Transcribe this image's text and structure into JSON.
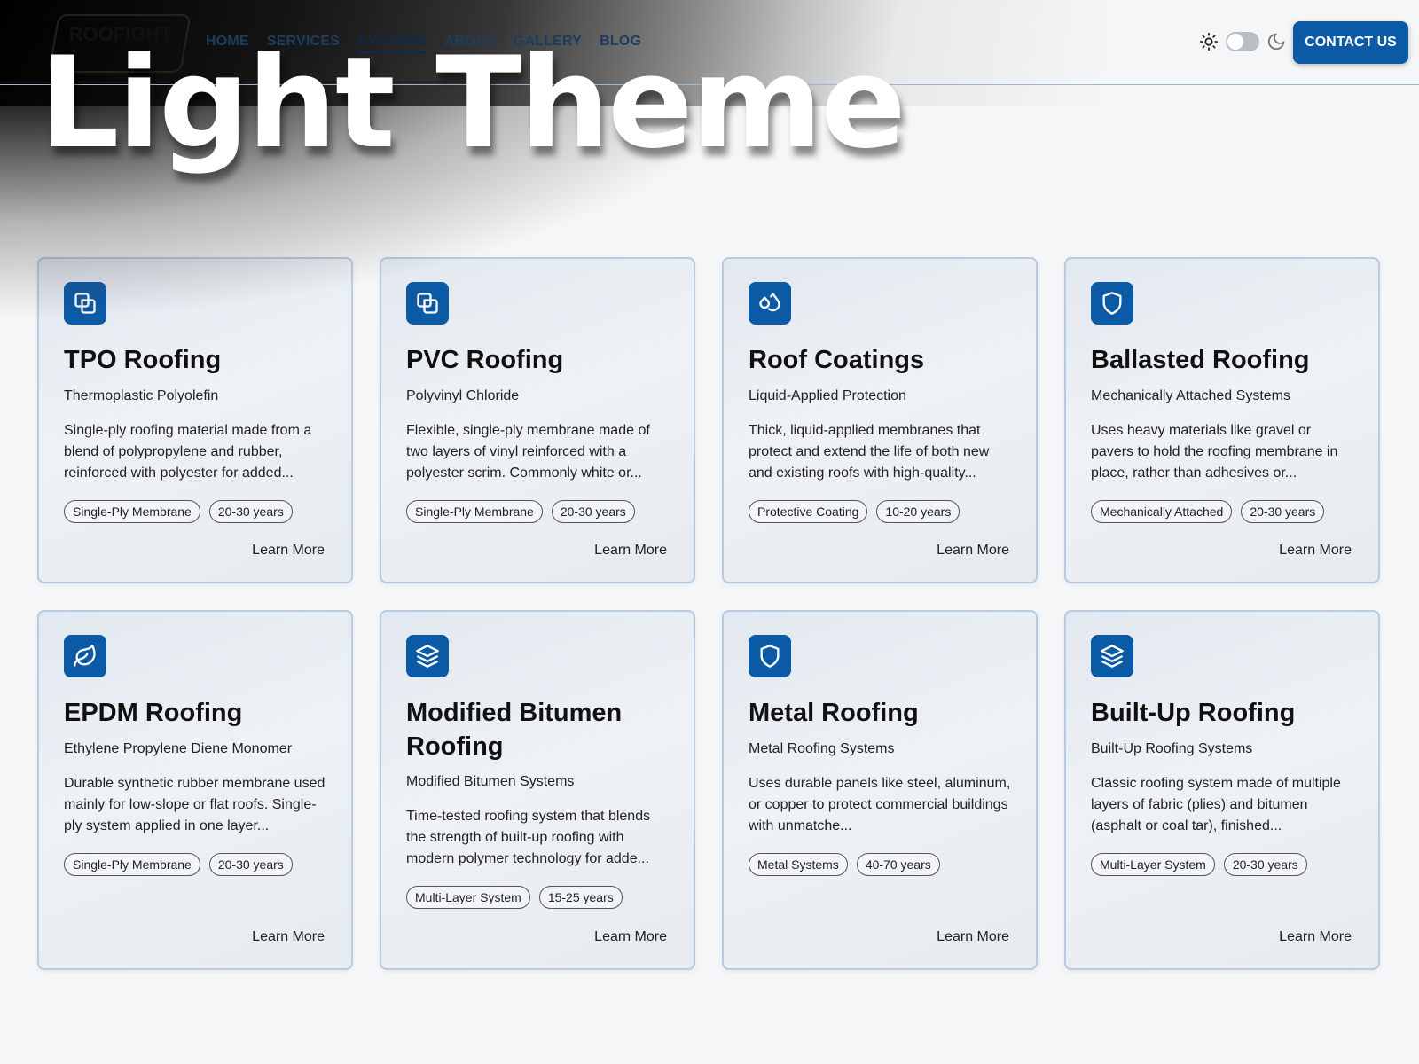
{
  "overlay_title": "Light Theme",
  "header": {
    "logo_text": "ROOFIGHT",
    "nav": [
      "HOME",
      "SERVICES",
      "SYSTEMS",
      "ABOUT",
      "GALLERY",
      "BLOG"
    ],
    "active_nav": "SYSTEMS",
    "contact_label": "CONTACT US",
    "accent_color": "#0b5aa6"
  },
  "cards": [
    {
      "icon": "squares-icon",
      "title": "TPO Roofing",
      "subtitle": "Thermoplastic Polyolefin",
      "description": "Single-ply roofing material made from a blend of polypropylene and rubber, reinforced with polyester for added...",
      "tags": [
        "Single-Ply Membrane",
        "20-30 years"
      ],
      "link": "Learn More"
    },
    {
      "icon": "squares-icon",
      "title": "PVC Roofing",
      "subtitle": "Polyvinyl Chloride",
      "description": "Flexible, single-ply membrane made of two layers of vinyl reinforced with a polyester scrim. Commonly white or...",
      "tags": [
        "Single-Ply Membrane",
        "20-30 years"
      ],
      "link": "Learn More"
    },
    {
      "icon": "droplets-icon",
      "title": "Roof Coatings",
      "subtitle": "Liquid-Applied Protection",
      "description": "Thick, liquid-applied membranes that protect and extend the life of both new and existing roofs with high-quality...",
      "tags": [
        "Protective Coating",
        "10-20 years"
      ],
      "link": "Learn More"
    },
    {
      "icon": "shield-icon",
      "title": "Ballasted Roofing",
      "subtitle": "Mechanically Attached Systems",
      "description": "Uses heavy materials like gravel or pavers to hold the roofing membrane in place, rather than adhesives or...",
      "tags": [
        "Mechanically Attached",
        "20-30 years"
      ],
      "link": "Learn More"
    },
    {
      "icon": "leaf-icon",
      "title": "EPDM Roofing",
      "subtitle": "Ethylene Propylene Diene Monomer",
      "description": "Durable synthetic rubber membrane used mainly for low-slope or flat roofs. Single-ply system applied in one layer...",
      "tags": [
        "Single-Ply Membrane",
        "20-30 years"
      ],
      "link": "Learn More"
    },
    {
      "icon": "layers-icon",
      "title": "Modified Bitumen Roofing",
      "subtitle": "Modified Bitumen Systems",
      "description": "Time-tested roofing system that blends the strength of built-up roofing with modern polymer technology for adde...",
      "tags": [
        "Multi-Layer System",
        "15-25 years"
      ],
      "link": "Learn More"
    },
    {
      "icon": "shield-icon",
      "title": "Metal Roofing",
      "subtitle": "Metal Roofing Systems",
      "description": "Uses durable panels like steel, aluminum, or copper to protect commercial buildings with unmatche...",
      "tags": [
        "Metal Systems",
        "40-70 years"
      ],
      "link": "Learn More"
    },
    {
      "icon": "layers-icon",
      "title": "Built-Up Roofing",
      "subtitle": "Built-Up Roofing Systems",
      "description": "Classic roofing system made of multiple layers of fabric (plies) and bitumen (asphalt or coal tar), finished...",
      "tags": [
        "Multi-Layer System",
        "20-30 years"
      ],
      "link": "Learn More"
    }
  ]
}
